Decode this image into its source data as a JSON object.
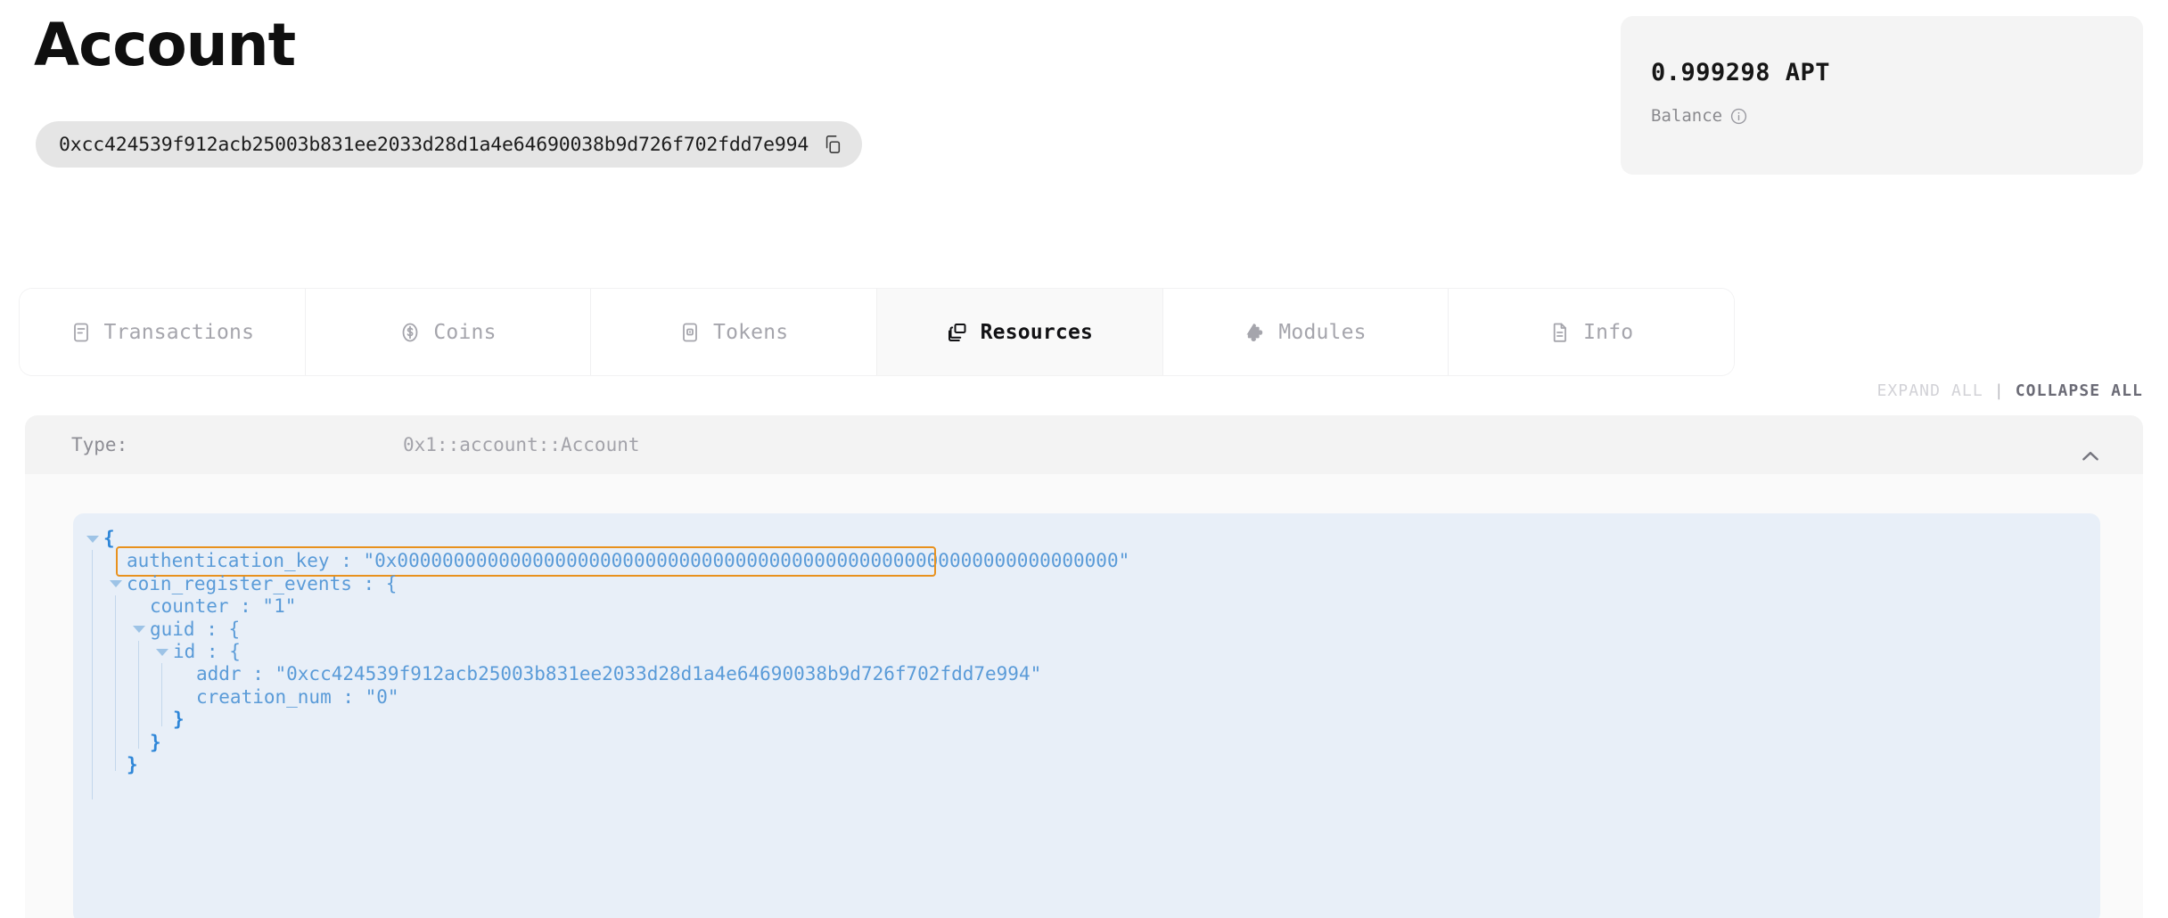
{
  "header": {
    "title": "Account",
    "address": "0xcc424539f912acb25003b831ee2033d28d1a4e64690038b9d726f702fdd7e994",
    "copy_icon": "copy-icon"
  },
  "balance": {
    "amount": "0.999298 APT",
    "label": "Balance",
    "info_icon": "info-circle-icon"
  },
  "tabs": [
    {
      "label": "Transactions",
      "icon": "receipt-icon",
      "active": false
    },
    {
      "label": "Coins",
      "icon": "coin-dollar-icon",
      "active": false
    },
    {
      "label": "Tokens",
      "icon": "token-icon",
      "active": false
    },
    {
      "label": "Resources",
      "icon": "layers-copy-icon",
      "active": true
    },
    {
      "label": "Modules",
      "icon": "puzzle-piece-icon",
      "active": false
    },
    {
      "label": "Info",
      "icon": "document-icon",
      "active": false
    }
  ],
  "tree_controls": {
    "expand_all": "EXPAND ALL",
    "separator": "|",
    "collapse_all": "COLLAPSE ALL"
  },
  "resource": {
    "type_key": "Type:",
    "type_value": "0x1::account::Account",
    "toggle_icon": "chevron-up-icon"
  },
  "json_lines": [
    {
      "indent": 0,
      "caret": true,
      "text": "{",
      "style": "brace"
    },
    {
      "indent": 1,
      "caret": false,
      "text": "authentication_key : \"0x0000000000000000000000000000000000000000000000000000000000000000\"",
      "style": "text",
      "highlighted": true
    },
    {
      "indent": 1,
      "caret": true,
      "text": "coin_register_events : {",
      "style": "text"
    },
    {
      "indent": 2,
      "caret": false,
      "text": "counter : \"1\"",
      "style": "text"
    },
    {
      "indent": 2,
      "caret": true,
      "text": "guid : {",
      "style": "text"
    },
    {
      "indent": 3,
      "caret": true,
      "text": "id : {",
      "style": "text"
    },
    {
      "indent": 4,
      "caret": false,
      "text": "addr : \"0xcc424539f912acb25003b831ee2033d28d1a4e64690038b9d726f702fdd7e994\"",
      "style": "text"
    },
    {
      "indent": 4,
      "caret": false,
      "text": "creation_num : \"0\"",
      "style": "text"
    },
    {
      "indent": 3,
      "caret": false,
      "text": "}",
      "style": "brace"
    },
    {
      "indent": 2,
      "caret": false,
      "text": "}",
      "style": "brace"
    },
    {
      "indent": 1,
      "caret": false,
      "text": "}",
      "style": "brace"
    }
  ],
  "colors": {
    "accent_highlight": "#e8911e",
    "json_bg": "#e8eff8",
    "json_text": "#5a9bd8",
    "json_brace": "#2e86d8",
    "card_bg": "#fafafa",
    "card_header_bg": "#f3f3f3",
    "pill_bg": "#e5e5e5",
    "balance_bg": "#f4f4f4"
  }
}
